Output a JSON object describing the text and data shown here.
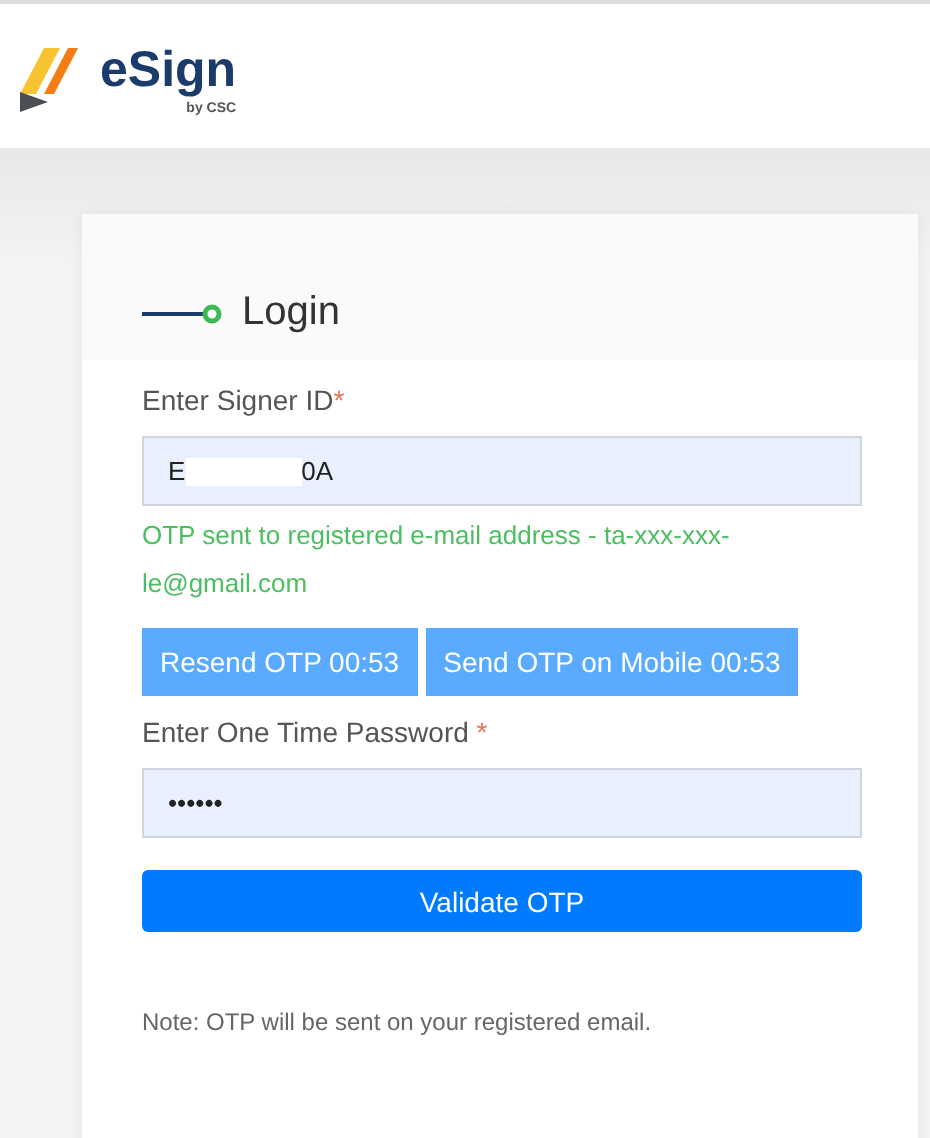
{
  "header": {
    "logo_name": "eSign",
    "logo_byline": "by CSC"
  },
  "login": {
    "title": "Login",
    "signer_id": {
      "label": "Enter Signer ID",
      "required_mark": "*",
      "value_start": "E",
      "value_end": "0A",
      "redacted": true
    },
    "message": "OTP sent to registered e-mail address - ta-xxx-xxx-le@gmail.com",
    "otp_buttons": [
      "Resend OTP 00:53",
      "Send OTP on Mobile 00:53"
    ],
    "otp": {
      "label": "Enter One Time Password",
      "required_mark": "*",
      "value": "••••••"
    },
    "submit": "Validate OTP",
    "note": "Note: OTP will be sent on your registered email."
  }
}
